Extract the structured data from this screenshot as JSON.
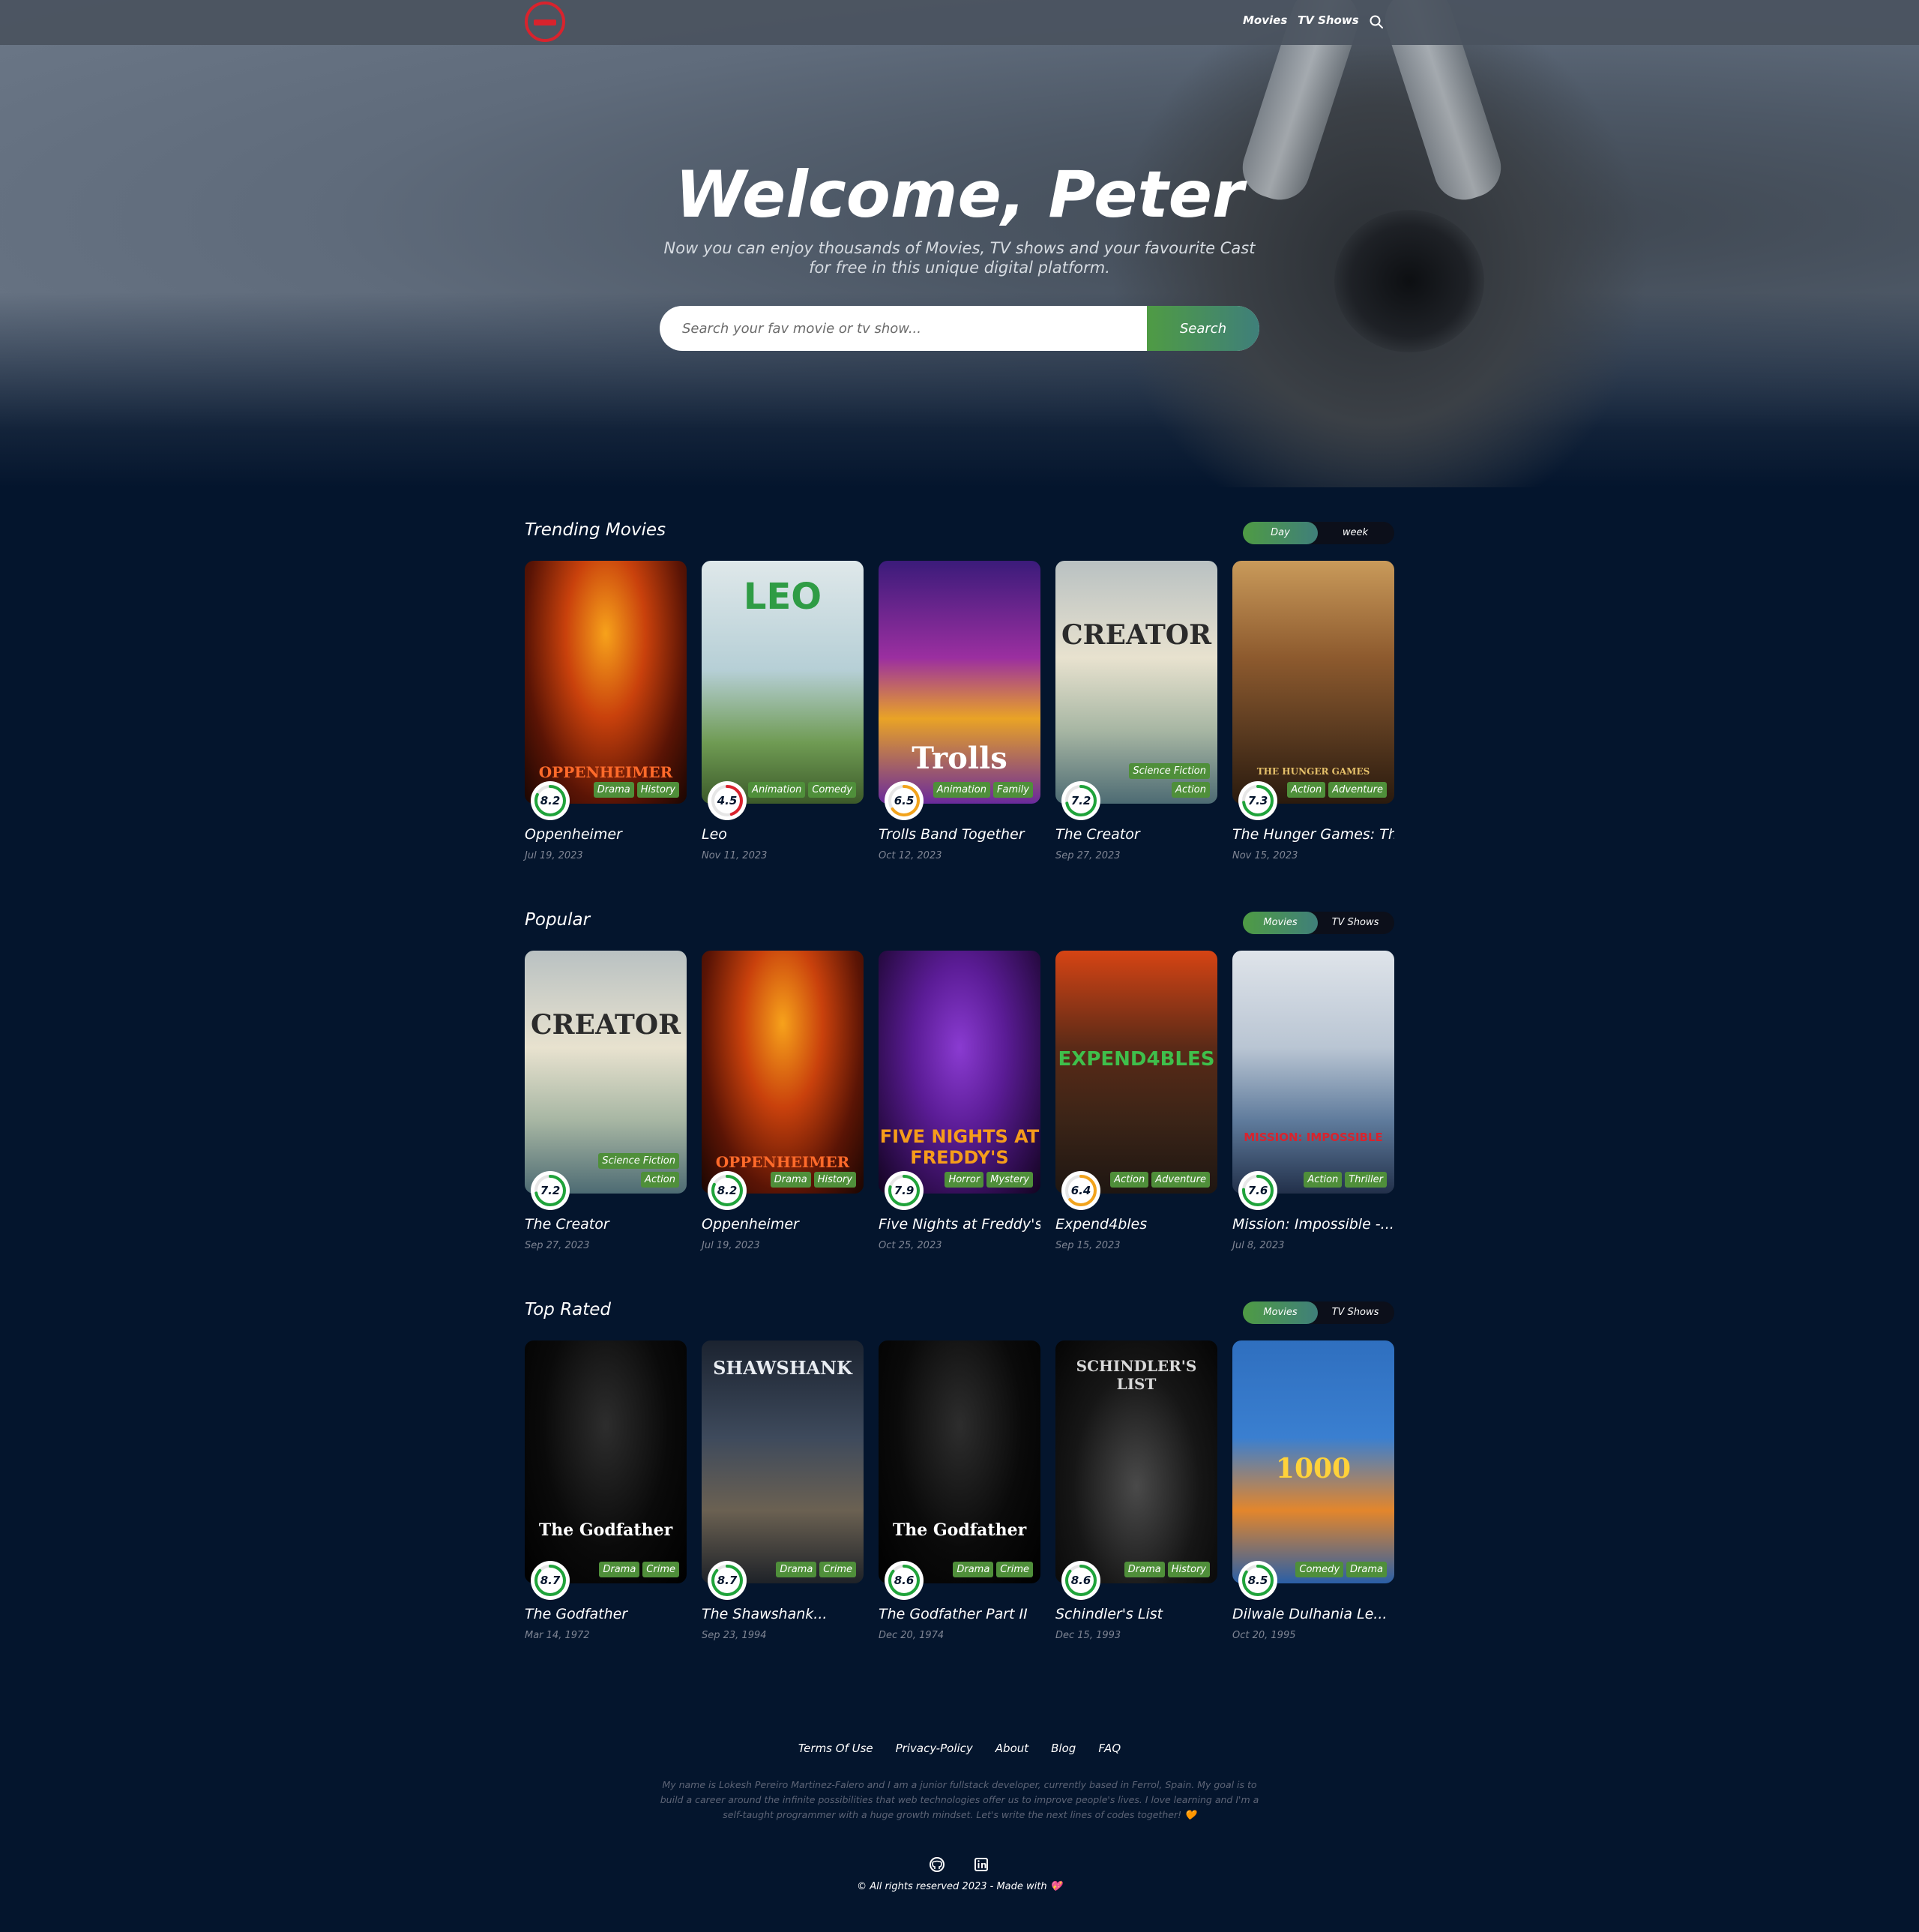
{
  "nav": {
    "links": [
      "Movies",
      "TV Shows"
    ],
    "search_icon": "search-icon",
    "logo_icon": "logo-icon"
  },
  "hero": {
    "title": "Welcome, Peter",
    "subtitle": "Now you can enjoy thousands of Movies, TV shows and your favourite Cast for free in this unique digital platform.",
    "search_placeholder": "Search your fav movie or tv show...",
    "search_button": "Search"
  },
  "colors": {
    "background": "#04152d",
    "accent_start": "#4f9b44",
    "accent_end": "#3f7f7a",
    "rating_high": "#1fa33a",
    "rating_mid": "#f2a31c",
    "rating_low": "#d9232d",
    "genre_bg": "#4f8f3a"
  },
  "sections": [
    {
      "title": "Trending Movies",
      "tabs": [
        "Day",
        "week"
      ],
      "active_tab": 0,
      "items": [
        {
          "title": "Oppenheimer",
          "date": "Jul 19, 2023",
          "rating": "8.2",
          "score": 82,
          "genres": [
            "Drama",
            "History"
          ],
          "poster_text": "OPPENHEIMER"
        },
        {
          "title": "Leo",
          "date": "Nov 11, 2023",
          "rating": "4.5",
          "score": 45,
          "genres": [
            "Animation",
            "Comedy"
          ],
          "poster_text": "LEO"
        },
        {
          "title": "Trolls Band Together",
          "date": "Oct 12, 2023",
          "rating": "6.5",
          "score": 65,
          "genres": [
            "Animation",
            "Family"
          ],
          "poster_text": "Trolls"
        },
        {
          "title": "The Creator",
          "date": "Sep 27, 2023",
          "rating": "7.2",
          "score": 72,
          "genres": [
            "Science Fiction",
            "Action"
          ],
          "poster_text": "CREATOR"
        },
        {
          "title": "The Hunger Games: Th...",
          "date": "Nov 15, 2023",
          "rating": "7.3",
          "score": 73,
          "genres": [
            "Action",
            "Adventure"
          ],
          "poster_text": "THE HUNGER GAMES"
        }
      ]
    },
    {
      "title": "Popular",
      "tabs": [
        "Movies",
        "TV Shows"
      ],
      "active_tab": 0,
      "items": [
        {
          "title": "The Creator",
          "date": "Sep 27, 2023",
          "rating": "7.2",
          "score": 72,
          "genres": [
            "Science Fiction",
            "Action"
          ],
          "poster_text": "CREATOR"
        },
        {
          "title": "Oppenheimer",
          "date": "Jul 19, 2023",
          "rating": "8.2",
          "score": 82,
          "genres": [
            "Drama",
            "History"
          ],
          "poster_text": "OPPENHEIMER"
        },
        {
          "title": "Five Nights at Freddy's",
          "date": "Oct 25, 2023",
          "rating": "7.9",
          "score": 79,
          "genres": [
            "Horror",
            "Mystery"
          ],
          "poster_text": "FIVE NIGHTS AT FREDDY'S"
        },
        {
          "title": "Expend4bles",
          "date": "Sep 15, 2023",
          "rating": "6.4",
          "score": 64,
          "genres": [
            "Action",
            "Adventure"
          ],
          "poster_text": "EXPEND4BLES"
        },
        {
          "title": "Mission: Impossible -...",
          "date": "Jul 8, 2023",
          "rating": "7.6",
          "score": 76,
          "genres": [
            "Action",
            "Thriller"
          ],
          "poster_text": "MISSION: IMPOSSIBLE"
        }
      ]
    },
    {
      "title": "Top Rated",
      "tabs": [
        "Movies",
        "TV Shows"
      ],
      "active_tab": 0,
      "items": [
        {
          "title": "The Godfather",
          "date": "Mar 14, 1972",
          "rating": "8.7",
          "score": 87,
          "genres": [
            "Drama",
            "Crime"
          ],
          "poster_text": "The Godfather"
        },
        {
          "title": "The Shawshank...",
          "date": "Sep 23, 1994",
          "rating": "8.7",
          "score": 87,
          "genres": [
            "Drama",
            "Crime"
          ],
          "poster_text": "SHAWSHANK"
        },
        {
          "title": "The Godfather Part II",
          "date": "Dec 20, 1974",
          "rating": "8.6",
          "score": 86,
          "genres": [
            "Drama",
            "Crime"
          ],
          "poster_text": "The Godfather"
        },
        {
          "title": "Schindler's List",
          "date": "Dec 15, 1993",
          "rating": "8.6",
          "score": 86,
          "genres": [
            "Drama",
            "History"
          ],
          "poster_text": "SCHINDLER'S LIST"
        },
        {
          "title": "Dilwale Dulhania Le...",
          "date": "Oct 20, 1995",
          "rating": "8.5",
          "score": 85,
          "genres": [
            "Comedy",
            "Drama"
          ],
          "poster_text": "1000"
        }
      ]
    }
  ],
  "footer": {
    "links": [
      "Terms Of Use",
      "Privacy-Policy",
      "About",
      "Blog",
      "FAQ"
    ],
    "about_text": "My name is Lokesh Pereiro Martinez-Falero and I am a junior fullstack developer, currently based in Ferrol, Spain. My goal is to build a career around the infinite possibilities that web technologies offer us to improve people's lives. I love learning and I'm a self-taught programmer with a huge growth mindset. Let's write the next lines of codes together! 🧡",
    "social": [
      "github-icon",
      "linkedin-icon"
    ],
    "copyright": "© All rights reserved 2023 - Made with 💖"
  }
}
